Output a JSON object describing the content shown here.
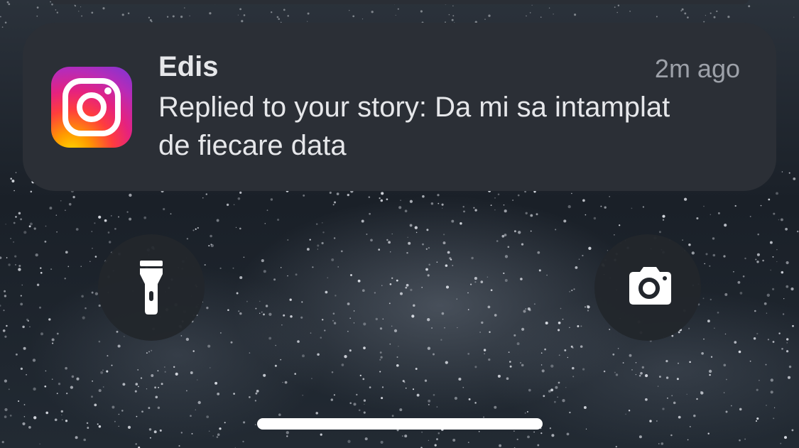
{
  "notification": {
    "app_icon": "instagram-icon",
    "sender": "Edis",
    "time": "2m ago",
    "message": "Replied to your story: Da mi sa intamplat de fiecare data"
  },
  "controls": {
    "flashlight_icon": "flashlight-icon",
    "camera_icon": "camera-icon"
  },
  "colors": {
    "notification_bg": "#2b2f36",
    "text_primary": "#e6e7ea",
    "text_secondary": "#9da1a9",
    "button_bg": "#22262c",
    "home_indicator": "#ffffff"
  }
}
